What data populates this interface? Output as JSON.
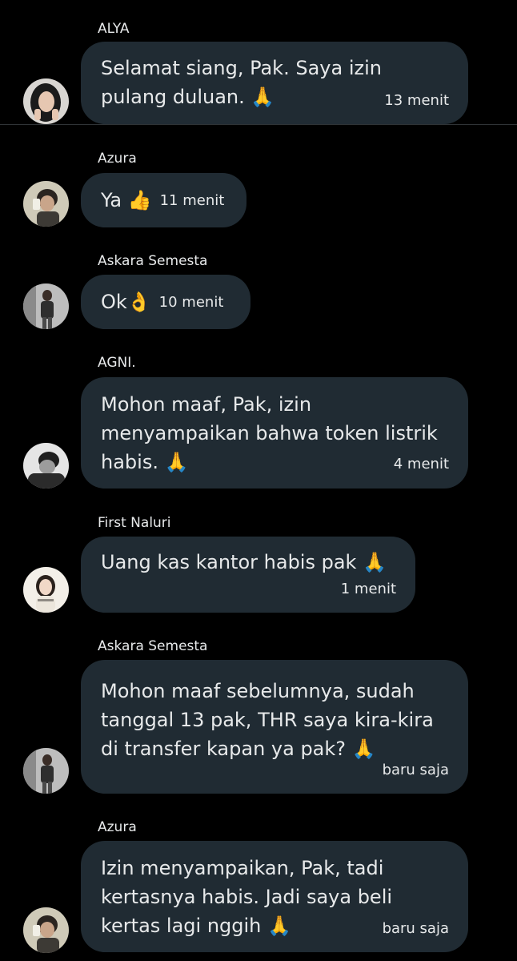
{
  "messages": [
    {
      "sender": "ALYA",
      "text": "Selamat siang, Pak. Saya izin\npulang duluan. 🙏",
      "time": "13 menit",
      "avatar": "avatar-girl-dark"
    },
    {
      "sender": "Azura",
      "text": "Ya 👍",
      "time": "11 menit",
      "avatar": "avatar-boy-phone"
    },
    {
      "sender": "Askara Semesta",
      "text": "Ok👌",
      "time": "10 menit",
      "avatar": "avatar-man-standing"
    },
    {
      "sender": "AGNI.",
      "text": "Mohon maaf, Pak, izin\nmenyampaikan bahwa token listrik\nhabis. 🙏",
      "time": "4 menit",
      "avatar": "avatar-bw-portrait"
    },
    {
      "sender": "First Naluri",
      "text": "Uang kas kantor habis pak 🙏",
      "time": "1 menit",
      "avatar": "avatar-girl-light"
    },
    {
      "sender": "Askara Semesta",
      "text": "Mohon maaf sebelumnya, sudah\ntanggal 13 pak,  THR saya kira-kira\ndi transfer kapan ya pak? 🙏",
      "time": "baru saja",
      "avatar": "avatar-man-standing"
    },
    {
      "sender": "Azura",
      "text": "Izin menyampaikan, Pak, tadi\nkertasnya habis. Jadi saya beli\nkertas lagi nggih 🙏",
      "time": "baru saja",
      "avatar": "avatar-boy-phone"
    }
  ],
  "colors": {
    "background": "#000000",
    "bubble": "#202b33",
    "text": "#e7e9ea",
    "divider": "#2f3336"
  }
}
